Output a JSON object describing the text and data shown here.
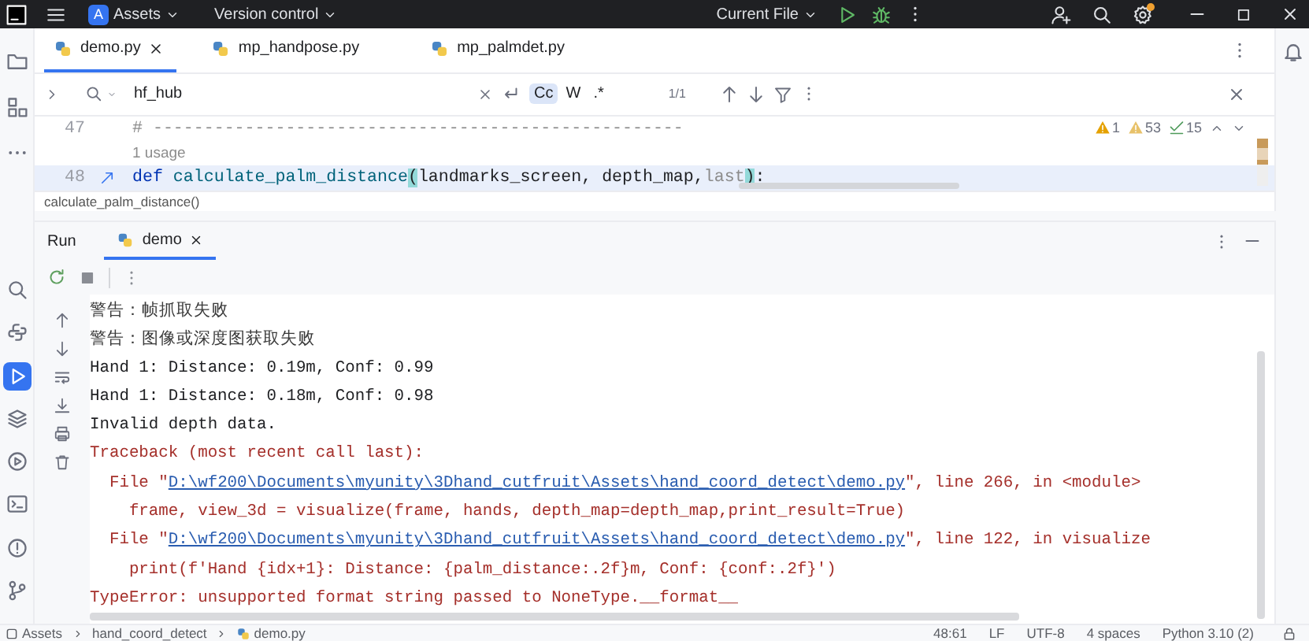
{
  "title_bar": {
    "project_badge": "A",
    "project": "Assets",
    "vcs": "Version control",
    "run_config": "Current File",
    "settings_badge": true
  },
  "tool_windows_top": [
    {
      "selected": false
    },
    {
      "selected": false
    },
    {
      "selected": false
    }
  ],
  "tool_windows_bottom": [
    {
      "selected": false
    },
    {
      "selected": false
    },
    {
      "selected": true
    },
    {
      "selected": false
    },
    {
      "selected": false
    },
    {
      "selected": false
    },
    {
      "selected": false
    },
    {
      "selected": false
    }
  ],
  "tabs": [
    {
      "label": "demo.py",
      "selected": true
    },
    {
      "label": "mp_handpose.py",
      "selected": false
    },
    {
      "label": "mp_palmdet.py",
      "selected": false
    }
  ],
  "find_bar": {
    "value": "hf_hub",
    "result": "1/1",
    "options": [
      {
        "label": "Cc",
        "selected": true
      },
      {
        "label": "W",
        "selected": false
      },
      {
        "label": ".*",
        "selected": false
      }
    ]
  },
  "inspections": [
    {
      "kind": "warning",
      "count": "1"
    },
    {
      "kind": "weak_warning",
      "count": "53"
    },
    {
      "kind": "typo",
      "count": "15"
    }
  ],
  "code": [
    {
      "kind": "line",
      "number": "47",
      "current": false,
      "gutter_mark": false,
      "tokens": [
        {
          "kind": "comment",
          "text": "# ----------------------------------------------------"
        }
      ]
    },
    {
      "kind": "hint",
      "text": "1 usage"
    },
    {
      "kind": "line",
      "number": "48",
      "current": true,
      "gutter_mark": true,
      "tokens": [
        {
          "kind": "keyword",
          "text": "def"
        },
        {
          "kind": "function",
          "text": " calculate_palm_distance"
        },
        {
          "kind": "brace",
          "text": "("
        },
        {
          "kind": "plain",
          "text": "landmarks_screen, depth_map,"
        },
        {
          "kind": "unused",
          "text": "last"
        },
        {
          "kind": "brace",
          "text": ")"
        },
        {
          "kind": "plain",
          "text": ":"
        }
      ]
    }
  ],
  "breadcrumb": "calculate_palm_distance()",
  "run_panel": {
    "title": "Run",
    "tabs": [
      {
        "label": "demo",
        "selected": true
      }
    ],
    "console": [
      {
        "kind": "warning",
        "text": "警告：帧抓取失败"
      },
      {
        "kind": "warning",
        "text": "警告：图像或深度图获取失败"
      },
      {
        "kind": "output",
        "text": "Hand 1: Distance: 0.19m, Conf: 0.99"
      },
      {
        "kind": "output",
        "text": "Hand 1: Distance: 0.18m, Conf: 0.98"
      },
      {
        "kind": "output",
        "text": "Invalid depth data."
      },
      {
        "kind": "error",
        "text": "Traceback (most recent call last):"
      },
      {
        "kind": "error_link",
        "prefix": "  File \"",
        "link": "D:\\wf200\\Documents\\myunity\\3Dhand_cutfruit\\Assets\\hand_coord_detect\\demo.py",
        "suffix": "\", line 266, in <module>"
      },
      {
        "kind": "error",
        "text": "    frame, view_3d = visualize(frame, hands, depth_map=depth_map,print_result=True)"
      },
      {
        "kind": "error_link",
        "prefix": "  File \"",
        "link": "D:\\wf200\\Documents\\myunity\\3Dhand_cutfruit\\Assets\\hand_coord_detect\\demo.py",
        "suffix": "\", line 122, in visualize"
      },
      {
        "kind": "error",
        "text": "    print(f'Hand {idx+1}: Distance: {palm_distance:.2f}m, Conf: {conf:.2f}')"
      },
      {
        "kind": "error",
        "text": "TypeError: unsupported format string passed to NoneType.__format__"
      }
    ]
  },
  "status_bar": {
    "path": [
      "Assets",
      "hand_coord_detect",
      "demo.py"
    ],
    "items": [
      "48:61",
      "LF",
      "UTF-8",
      "4 spaces",
      "Python 3.10 (2)"
    ]
  }
}
